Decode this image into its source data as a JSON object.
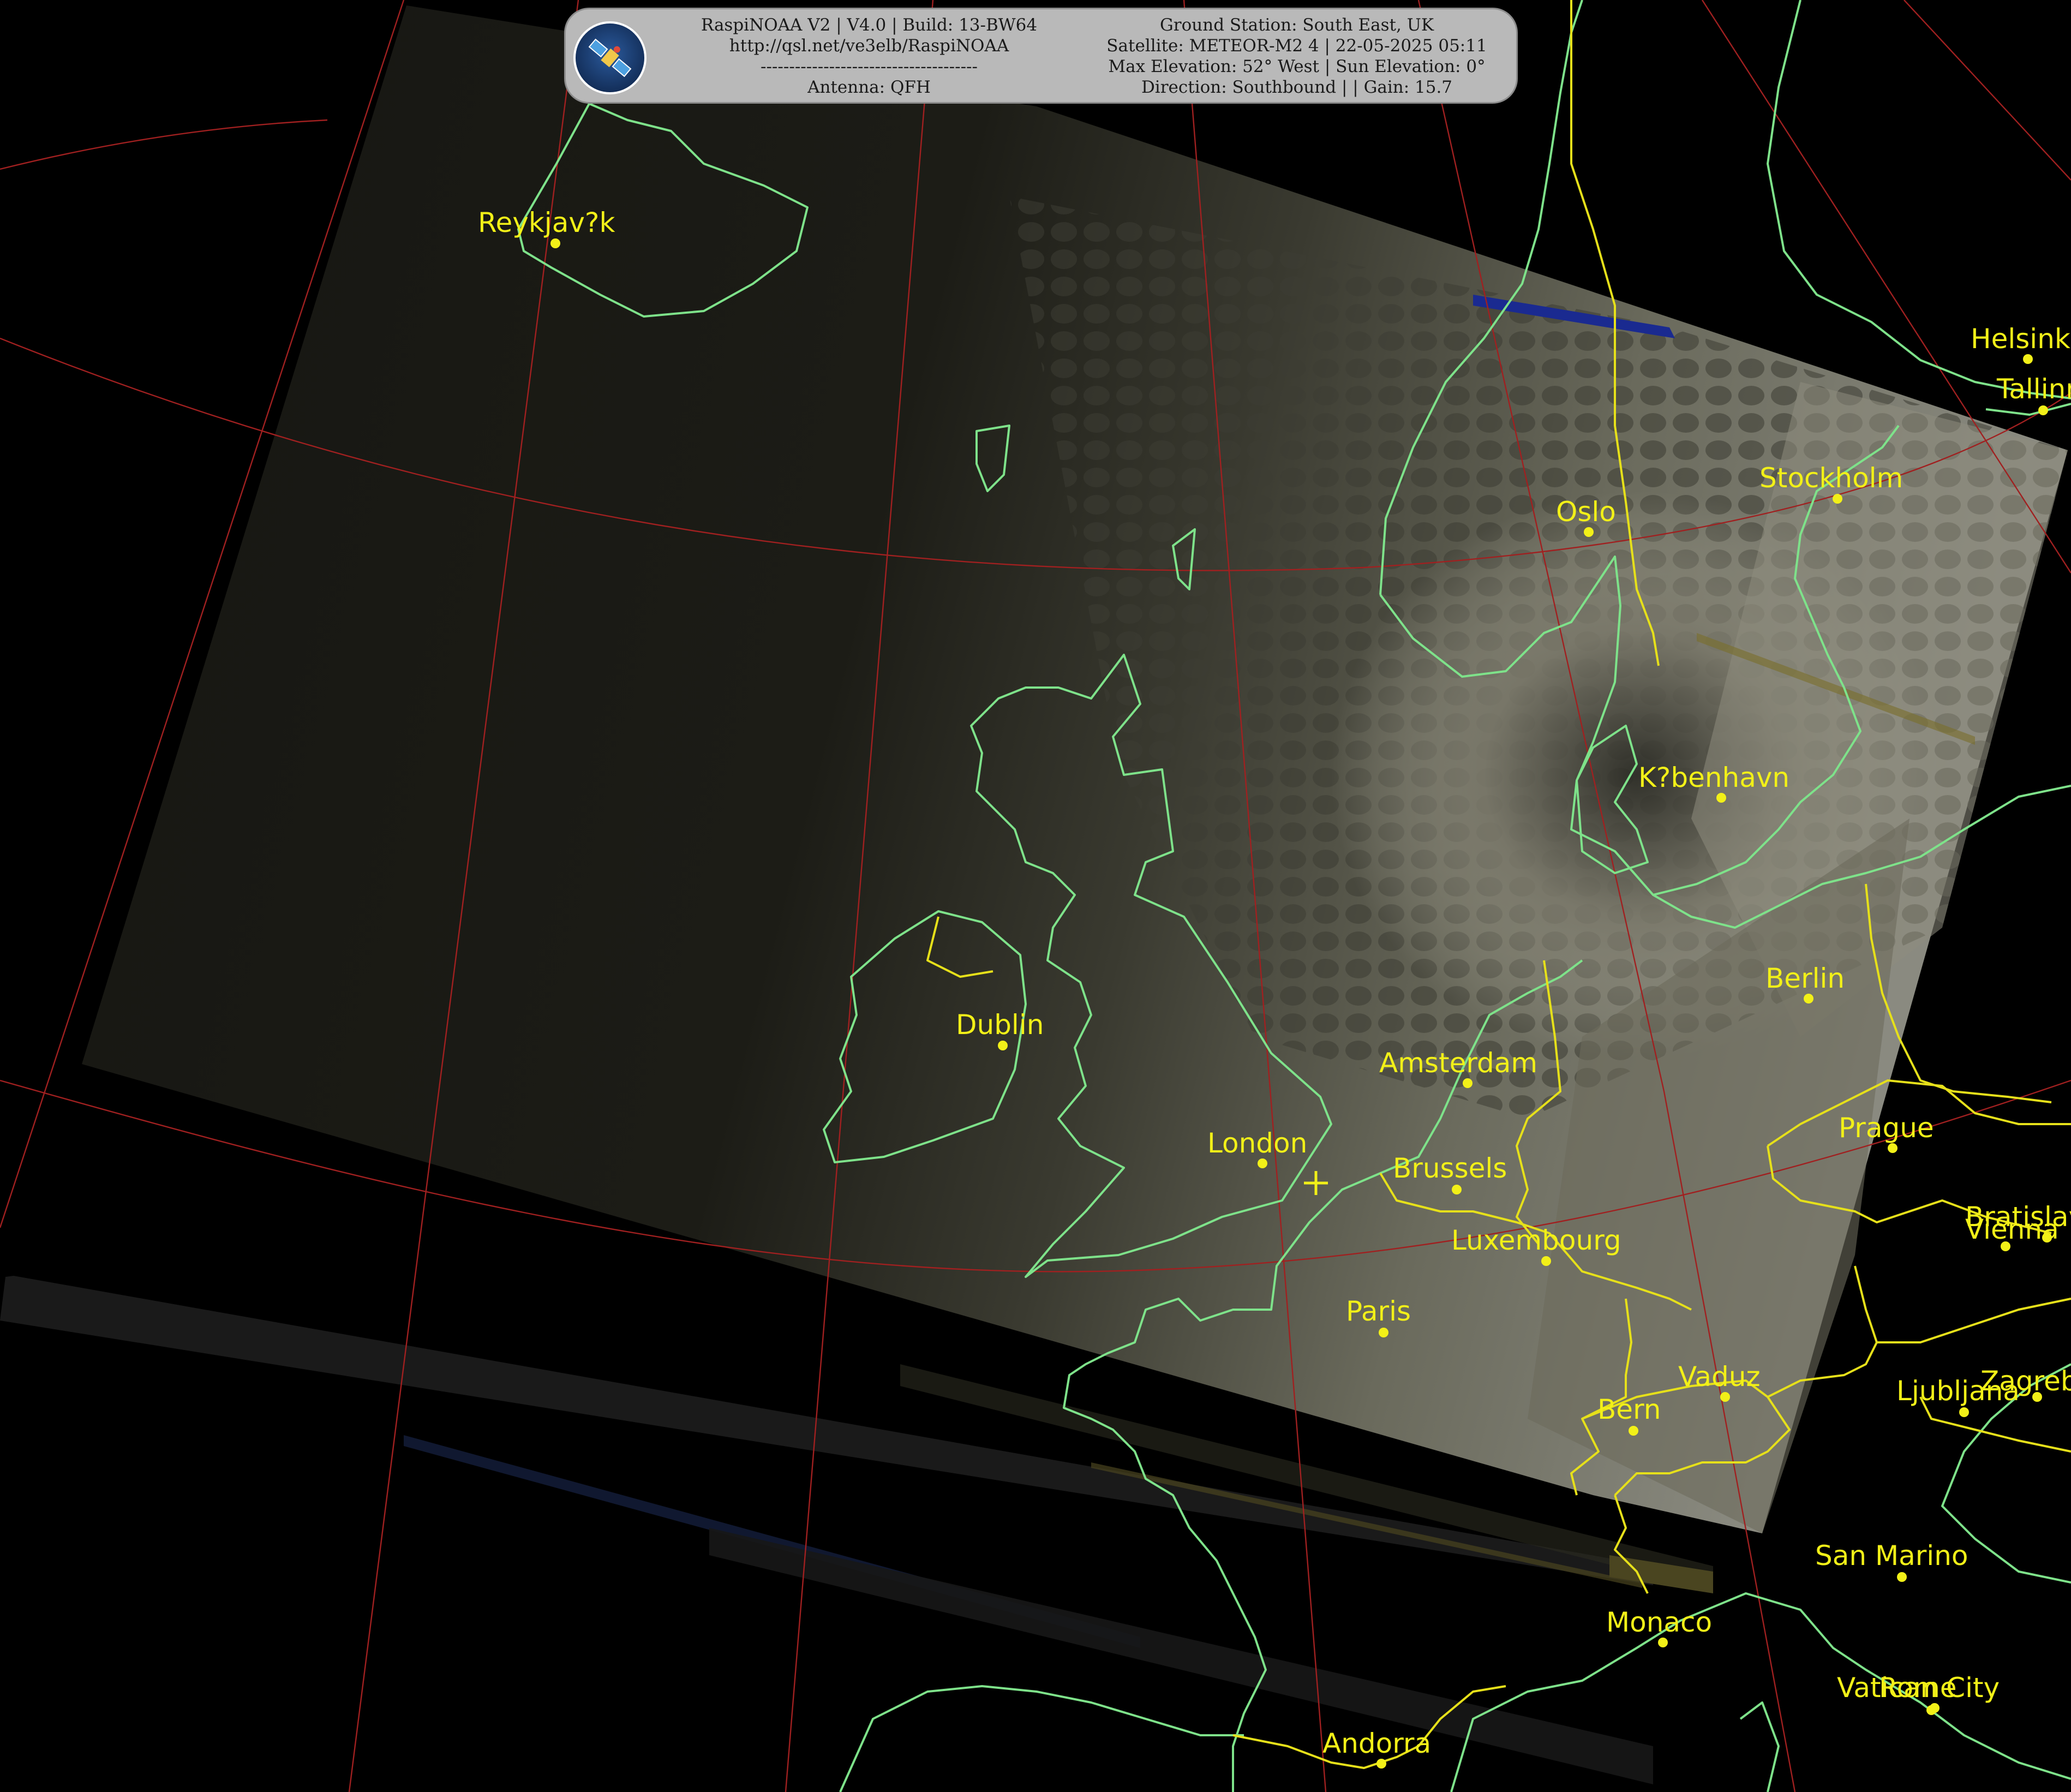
{
  "banner": {
    "left_lines": [
      "RaspiNOAA V2 | V4.0 | Build: 13-BW64",
      "http://qsl.net/ve3elb/RaspiNOAA",
      "--------------------------------------",
      "Antenna: QFH"
    ],
    "right_lines": [
      "Ground Station: South East, UK",
      "Satellite: METEOR-M2 4 | 22-05-2025 05:11",
      "Max Elevation: 52° West | Sun Elevation: 0°",
      "Direction: Southbound | | Gain: 15.7"
    ],
    "logo_icon": "satellite-icon"
  },
  "cities": [
    {
      "name": "Reykjav?k"
    },
    {
      "name": "Oslo"
    },
    {
      "name": "Stockholm"
    },
    {
      "name": "Helsinki"
    },
    {
      "name": "Tallinn"
    },
    {
      "name": "K?benhavn"
    },
    {
      "name": "Berlin"
    },
    {
      "name": "Dublin"
    },
    {
      "name": "Amsterdam"
    },
    {
      "name": "London"
    },
    {
      "name": "Brussels"
    },
    {
      "name": "Luxembourg"
    },
    {
      "name": "Paris"
    },
    {
      "name": "Prague"
    },
    {
      "name": "Bratislava"
    },
    {
      "name": "Vienna"
    },
    {
      "name": "Vaduz"
    },
    {
      "name": "Bern"
    },
    {
      "name": "Ljubljana"
    },
    {
      "name": "Zagreb"
    },
    {
      "name": "San Marino"
    },
    {
      "name": "Monaco"
    },
    {
      "name": "Vatican City"
    },
    {
      "name": "Rome"
    },
    {
      "name": "Andorra"
    }
  ],
  "ground_station_marker": "crosshair-icon",
  "colors": {
    "city": "#f2f018",
    "coastline": "#7ee28a",
    "border": "#e6e01a",
    "graticule": "#a02020",
    "background": "#000000"
  }
}
